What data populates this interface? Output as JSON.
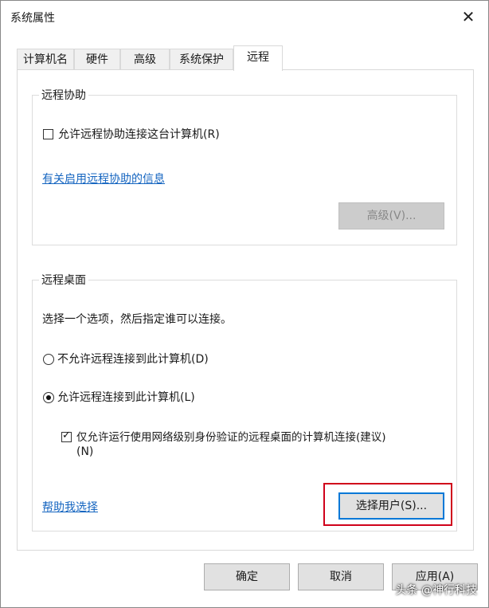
{
  "window": {
    "title": "系统属性",
    "close_glyph": "✕"
  },
  "tabs": [
    {
      "label": "计算机名"
    },
    {
      "label": "硬件"
    },
    {
      "label": "高级"
    },
    {
      "label": "系统保护"
    },
    {
      "label": "远程"
    }
  ],
  "remote_assistance": {
    "group_label": "远程协助",
    "allow_checkbox": {
      "label": "允许远程协助连接这台计算机(R)",
      "checked": false
    },
    "info_link": "有关启用远程协助的信息",
    "advanced_button": "高级(V)..."
  },
  "remote_desktop": {
    "group_label": "远程桌面",
    "instruction": "选择一个选项，然后指定谁可以连接。",
    "radio_disallow": {
      "label": "不允许远程连接到此计算机(D)",
      "checked": false
    },
    "radio_allow": {
      "label": "允许远程连接到此计算机(L)",
      "checked": true
    },
    "nla_checkbox": {
      "label_line1": "仅允许运行使用网络级别身份验证的远程桌面的计算机连接(建议)",
      "label_line2": "(N)",
      "checked": true
    },
    "help_link": "帮助我选择",
    "select_users_button": "选择用户(S)..."
  },
  "footer": {
    "ok_button": "确定",
    "cancel_button": "取消",
    "apply_button": "应用(A)"
  },
  "watermark": "头条 @神行科技",
  "colors": {
    "link": "#1565c0",
    "highlight": "#d0021b",
    "focus": "#0078d7"
  }
}
